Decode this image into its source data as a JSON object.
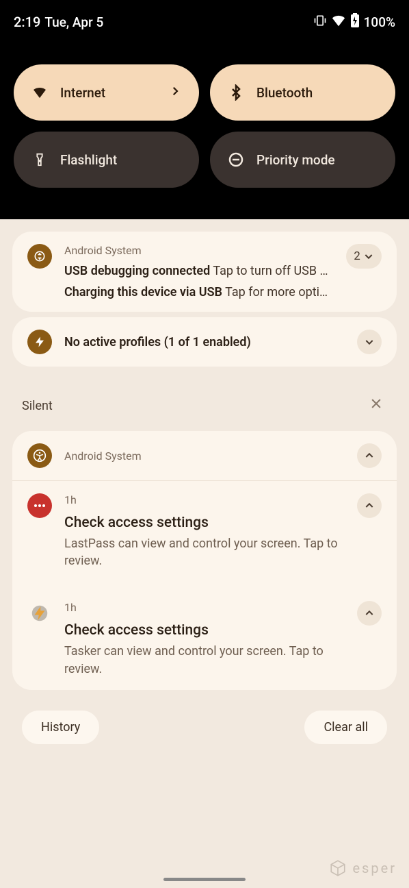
{
  "status": {
    "time": "2:19",
    "date": "Tue, Apr 5",
    "battery": "100%"
  },
  "qs": [
    {
      "label": "Internet",
      "active": true,
      "icon": "wifi",
      "chevron": true
    },
    {
      "label": "Bluetooth",
      "active": true,
      "icon": "bluetooth",
      "chevron": false
    },
    {
      "label": "Flashlight",
      "active": false,
      "icon": "flashlight",
      "chevron": false
    },
    {
      "label": "Priority mode",
      "active": false,
      "icon": "dnd",
      "chevron": false
    }
  ],
  "group1": {
    "app": "Android System",
    "count": "2",
    "lines": [
      {
        "bold": "USB debugging connected",
        "rest": "Tap to turn off USB debugg…"
      },
      {
        "bold": "Charging this device via USB",
        "rest": "Tap for more options."
      }
    ]
  },
  "profiles": {
    "title": "No active profiles (1 of 1 enabled)"
  },
  "silent_header": "Silent",
  "silent_app": "Android System",
  "silent": [
    {
      "time": "1h",
      "title": "Check access settings",
      "text": "LastPass can view and control your screen. Tap to review.",
      "icon": "red-dots"
    },
    {
      "time": "1h",
      "title": "Check access settings",
      "text": "Tasker can view and control your screen. Tap to review.",
      "icon": "gear"
    }
  ],
  "buttons": {
    "history": "History",
    "clear": "Clear all"
  },
  "watermark": "esper"
}
